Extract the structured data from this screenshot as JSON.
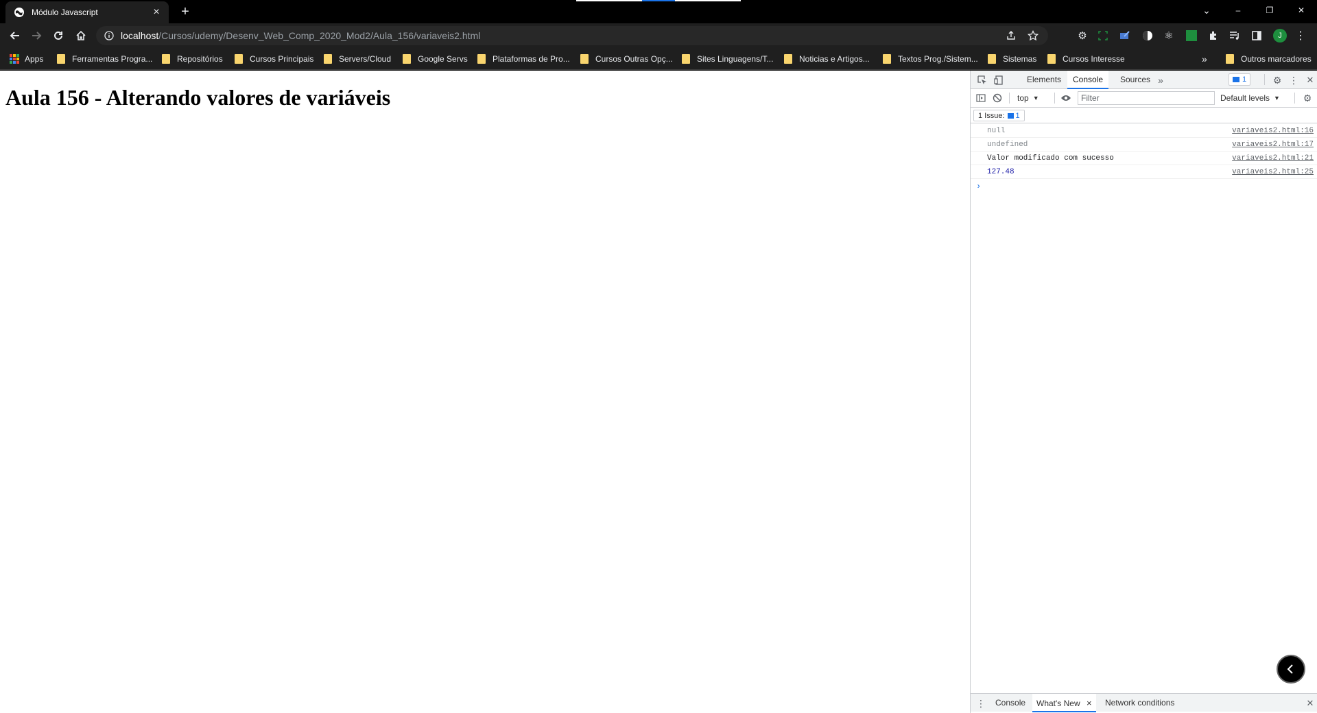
{
  "colors": {
    "browser_bg": "#1f1f1f",
    "accent": "#1a73e8",
    "folder": "#f9d56e",
    "profile": "#1e8e3e"
  },
  "tab": {
    "title": "Módulo Javascript",
    "close_label": "×",
    "new_tab_label": "+"
  },
  "window": {
    "minimize": "–",
    "restore": "❐",
    "close": "✕",
    "tab_search": "⌄"
  },
  "toolbar": {
    "url_host": "localhost",
    "url_path": "/Cursos/udemy/Desenv_Web_Comp_2020_Mod2/Aula_156/variaveis2.html",
    "profile_initial": "J"
  },
  "bookmarks": {
    "apps_label": "Apps",
    "items": [
      "Ferramentas Progra...",
      "Repositórios",
      "Cursos Principais",
      "Servers/Cloud",
      "Google Servs",
      "Plataformas de Pro...",
      "Cursos Outras Opç...",
      "Sites Linguagens/T...",
      "Noticias e Artigos...",
      "Textos Prog./Sistem...",
      "Sistemas",
      "Cursos Interesse"
    ],
    "overflow_label": "»",
    "other_label": "Outros marcadores"
  },
  "page": {
    "heading": "Aula 156 - Alterando valores de variáveis"
  },
  "devtools": {
    "tabs": [
      "Elements",
      "Console",
      "Sources"
    ],
    "active_tab": "Console",
    "more_tabs": "»",
    "messages_count": "1",
    "context": "top",
    "filter_placeholder": "Filter",
    "levels": "Default levels",
    "issues_label": "1 Issue:",
    "issues_count": "1",
    "logs": [
      {
        "value": "null",
        "source": "variaveis2.html:16"
      },
      {
        "value": "undefined",
        "source": "variaveis2.html:17"
      },
      {
        "value": "Valor modificado com sucesso",
        "source": "variaveis2.html:21"
      },
      {
        "value": "127.48",
        "source": "variaveis2.html:25"
      }
    ],
    "prompt": "›",
    "drawer": {
      "tabs": [
        "Console",
        "What's New",
        "Network conditions"
      ],
      "active_close": "×",
      "close": "✕"
    }
  }
}
